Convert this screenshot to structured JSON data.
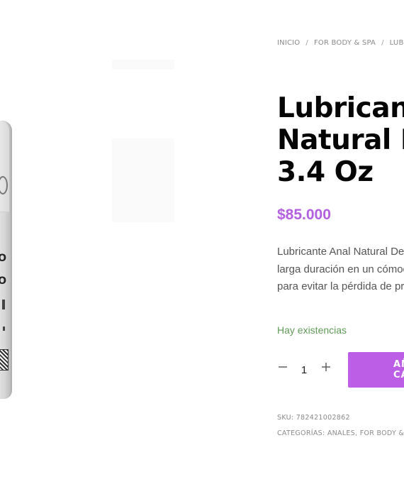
{
  "breadcrumb": {
    "items": [
      "INICIO",
      "FOR BODY & SPA",
      "LUBRICANTES"
    ],
    "separator": "/"
  },
  "product": {
    "title_lines": [
      "Lubricante Anal",
      "Natural Deluxe",
      "3.4 Oz"
    ],
    "price": "$85.000",
    "description_lines": [
      "Lubricante Anal Natural Deluxe de",
      "larga duración en un cómodo envase",
      "para evitar la pérdida de producto."
    ],
    "stock_status": "Hay existencias",
    "quantity": "1",
    "add_to_cart_label": "AÑADIR AL CARRITO",
    "sku_label": "SKU:",
    "sku_value": "782421002862",
    "categories_label": "CATEGORÍAS:",
    "categories": [
      "ANALES",
      "FOR BODY & SPA"
    ],
    "image_label_text": [
      "O",
      "O"
    ]
  },
  "colors": {
    "accent": "#bc5fe6",
    "price": "#b25fe0",
    "stock": "#5f9a57",
    "title": "#050505",
    "muted": "#8a8a8a"
  },
  "icons": {
    "minus": "minus-icon",
    "plus": "plus-icon"
  }
}
